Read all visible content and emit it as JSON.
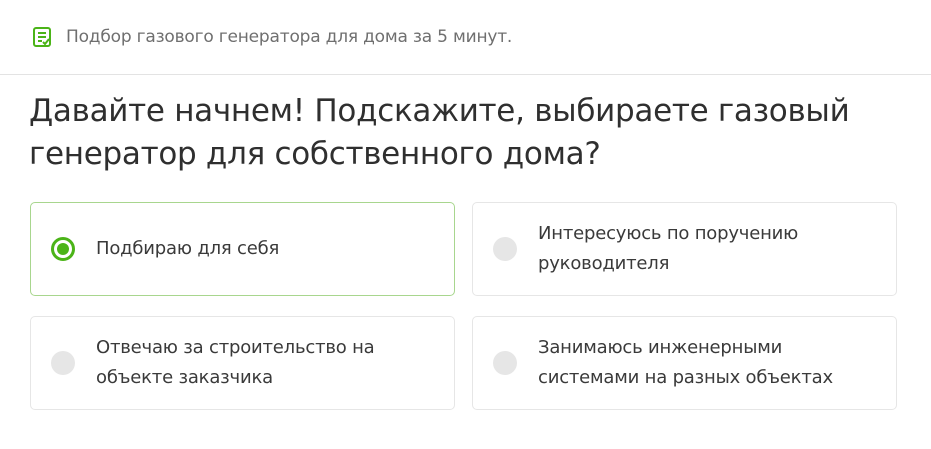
{
  "header": {
    "subtitle": "Подбор газового генератора для дома за 5 минут.",
    "icon": "checklist-icon"
  },
  "question": "Давайте начнем! Подскажите, выбираете газовый генератор для собственного дома?",
  "options": [
    {
      "label": "Подбираю для себя",
      "selected": true
    },
    {
      "label": "Интересуюсь по поручению руководителя",
      "selected": false
    },
    {
      "label": "Отвечаю за строительство на объекте заказчика",
      "selected": false
    },
    {
      "label": "Занимаюсь инженерными системами на разных объектах",
      "selected": false
    }
  ],
  "colors": {
    "accent": "#4bb418",
    "selected_border": "#a8d68e",
    "radio_empty": "#e6e6e6"
  }
}
